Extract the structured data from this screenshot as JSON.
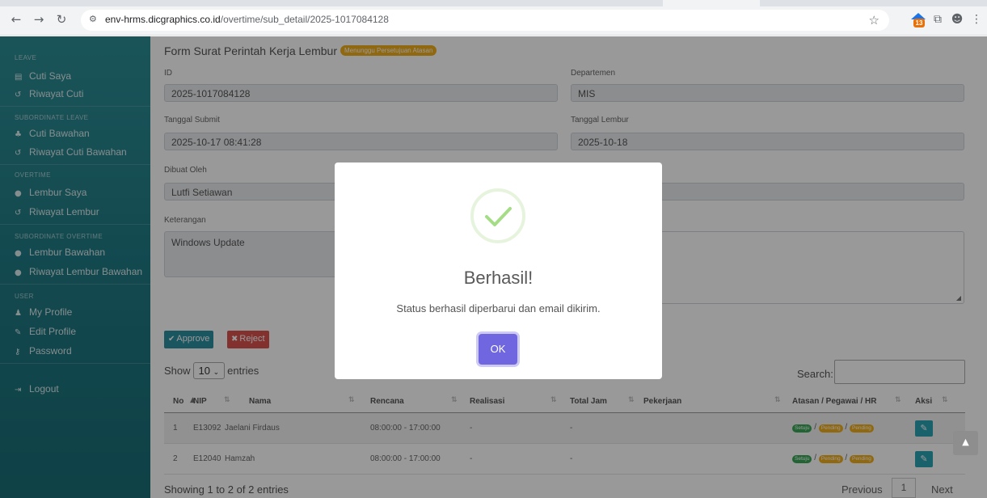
{
  "browser": {
    "url_host": "env-hrms.dicgraphics.co.id",
    "url_path": "/overtime/sub_detail/2025-1017084128",
    "extension_badge": "13"
  },
  "sidebar": {
    "sections": [
      {
        "title": "LEAVE",
        "items": [
          "Cuti Saya",
          "Riwayat Cuti"
        ]
      },
      {
        "title": "SUBORDINATE LEAVE",
        "items": [
          "Cuti Bawahan",
          "Riwayat Cuti Bawahan"
        ]
      },
      {
        "title": "OVERTIME",
        "items": [
          "Lembur Saya",
          "Riwayat Lembur"
        ]
      },
      {
        "title": "SUBORDINATE OVERTIME",
        "items": [
          "Lembur Bawahan",
          "Riwayat Lembur Bawahan"
        ]
      },
      {
        "title": "USER",
        "items": [
          "My Profile",
          "Edit Profile",
          "Password"
        ]
      }
    ],
    "logout": "Logout"
  },
  "form": {
    "title": "Form Surat Perintah Kerja Lembur",
    "status": "Menunggu Persetujuan Atasan",
    "id_label": "ID",
    "id_value": "2025-1017084128",
    "dept_label": "Departemen",
    "dept_value": "MIS",
    "submit_label": "Tanggal Submit",
    "submit_value": "2025-10-17 08:41:28",
    "lembur_label": "Tanggal Lembur",
    "lembur_value": "2025-10-18",
    "dibuat_label": "Dibuat Oleh",
    "dibuat_value": "Lutfi Setiawan",
    "ket_label": "Keterangan",
    "ket_value": "Windows Update",
    "approve": "Approve",
    "reject": "Reject"
  },
  "table": {
    "show": "Show",
    "entries_value": "10",
    "entries": "entries",
    "search": "Search:",
    "headers": [
      "No",
      "NIP",
      "Nama",
      "Rencana",
      "Realisasi",
      "Total Jam",
      "Pekerjaan",
      "Atasan / Pegawai / HR",
      "Aksi"
    ],
    "rows": [
      {
        "no": "1",
        "nip": "E13092",
        "nama": "Jaelani Firdaus",
        "rencana": "08:00:00 - 17:00:00",
        "realisasi": "-",
        "total": "-",
        "status": [
          "Setuju",
          "Pending",
          "Pending"
        ]
      },
      {
        "no": "2",
        "nip": "E12040",
        "nama": "Hamzah",
        "rencana": "08:00:00 - 17:00:00",
        "realisasi": "-",
        "total": "-",
        "status": [
          "Setuju",
          "Pending",
          "Pending"
        ]
      }
    ],
    "info": "Showing 1 to 2 of 2 entries",
    "previous": "Previous",
    "page": "1",
    "next": "Next"
  },
  "modal": {
    "title": "Berhasil!",
    "text": "Status berhasil diperbarui dan email dikirim.",
    "ok": "OK"
  },
  "colors": {
    "accent": "#7066e0",
    "sidebar": "#1f7a84",
    "success": "#a5dc86"
  }
}
